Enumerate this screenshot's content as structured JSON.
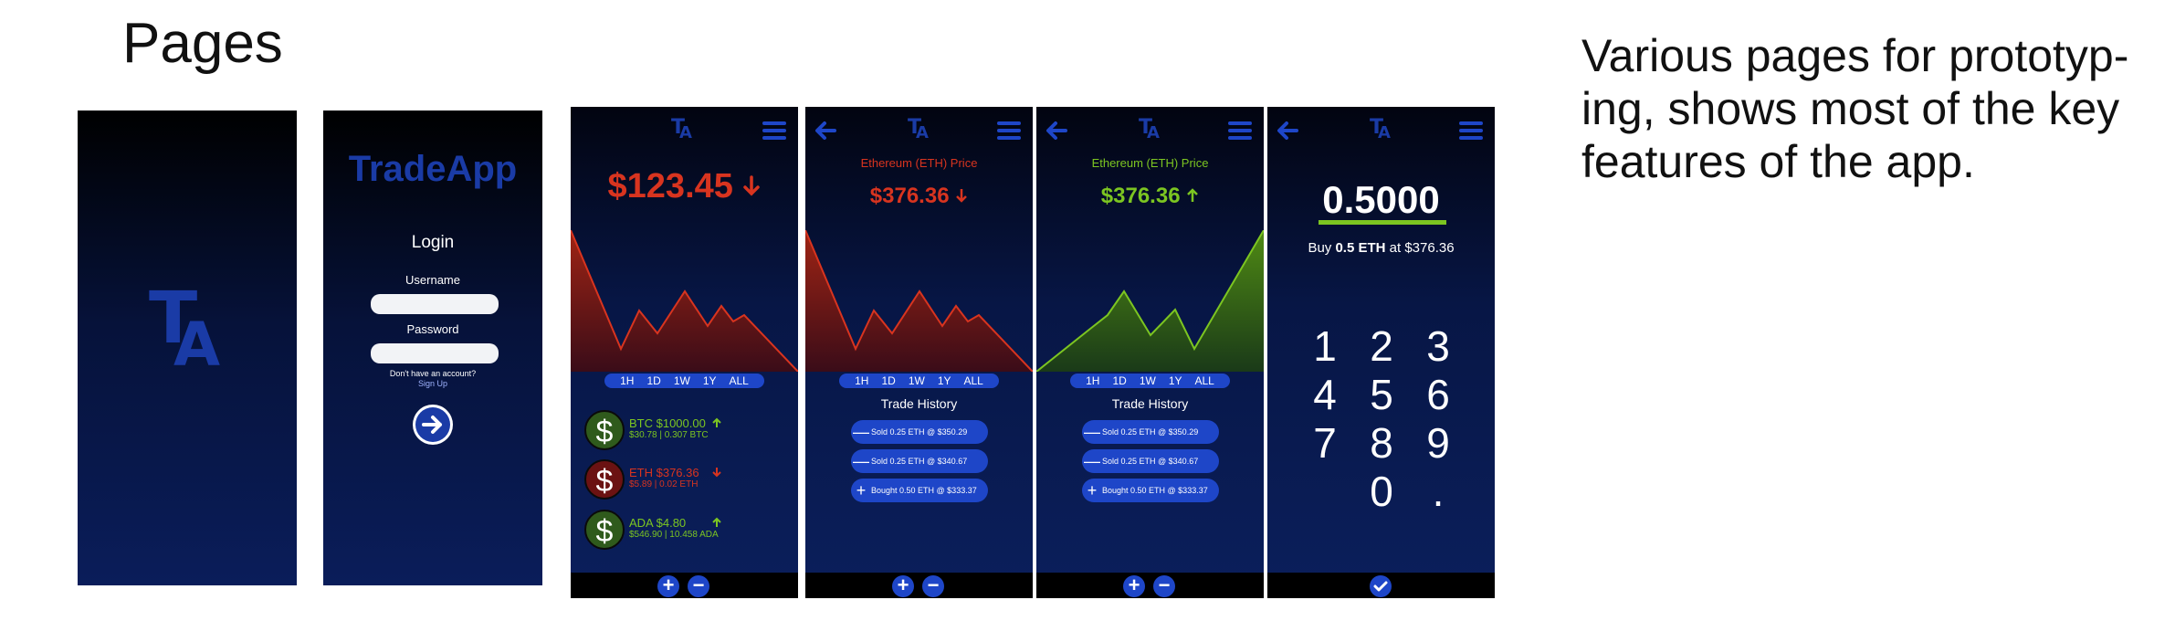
{
  "page": {
    "title": "Pages",
    "description": "Various pages for prototyp-ing, shows most of the key features of the app."
  },
  "splash": {
    "logo_t": "T",
    "logo_a": "A"
  },
  "login": {
    "brand": "TradeApp",
    "heading": "Login",
    "username_label": "Username",
    "password_label": "Password",
    "no_account": "Don't have an account?",
    "sign_up": "Sign Up"
  },
  "header": {
    "logo_t": "T",
    "logo_a": "A"
  },
  "home": {
    "price": "$123.45",
    "ranges": [
      "1H",
      "1D",
      "1W",
      "1Y",
      "ALL"
    ],
    "assets": [
      {
        "title": "BTC $1000.00",
        "sub": "$30.78 | 0.307 BTC",
        "coin": "$",
        "trend": "up"
      },
      {
        "title": "ETH $376.36",
        "sub": "$5.89 | 0.02 ETH",
        "coin": "$",
        "trend": "down"
      },
      {
        "title": "ADA $4.80",
        "sub": "$546.90 | 10.458 ADA",
        "coin": "$",
        "trend": "up"
      }
    ]
  },
  "eth_down": {
    "label": "Ethereum (ETH) Price",
    "price": "$376.36",
    "ranges": [
      "1H",
      "1D",
      "1W",
      "1Y",
      "ALL"
    ],
    "history_title": "Trade History",
    "trades": [
      {
        "sym": "—",
        "text": "Sold 0.25 ETH @ $350.29"
      },
      {
        "sym": "—",
        "text": "Sold 0.25 ETH @ $340.67"
      },
      {
        "sym": "+",
        "text": "Bought 0.50 ETH @ $333.37"
      }
    ]
  },
  "eth_up": {
    "label": "Ethereum (ETH) Price",
    "price": "$376.36",
    "ranges": [
      "1H",
      "1D",
      "1W",
      "1Y",
      "ALL"
    ],
    "history_title": "Trade History",
    "trades": [
      {
        "sym": "—",
        "text": "Sold 0.25 ETH @ $350.29"
      },
      {
        "sym": "—",
        "text": "Sold 0.25 ETH @ $340.67"
      },
      {
        "sym": "+",
        "text": "Bought 0.50 ETH @ $333.37"
      }
    ]
  },
  "buy": {
    "amount": "0.5000",
    "buy_prefix": "Buy ",
    "buy_amount": "0.5 ETH",
    "buy_suffix": " at $376.36",
    "keys": [
      "1",
      "2",
      "3",
      "4",
      "5",
      "6",
      "7",
      "8",
      "9",
      "0",
      "."
    ]
  },
  "controls": {
    "plus": "+",
    "minus": "−",
    "check": "✓",
    "arrow_right": "➔"
  },
  "colors": {
    "accent": "#1e46c8",
    "brand": "#1a3ba6",
    "down": "#d8341f",
    "up": "#7cc521"
  },
  "icons": [
    "menu-icon",
    "back-arrow-icon",
    "arrow-down-icon",
    "arrow-up-icon",
    "dollar-coin-icon",
    "check-icon",
    "plus-icon",
    "minus-icon"
  ]
}
